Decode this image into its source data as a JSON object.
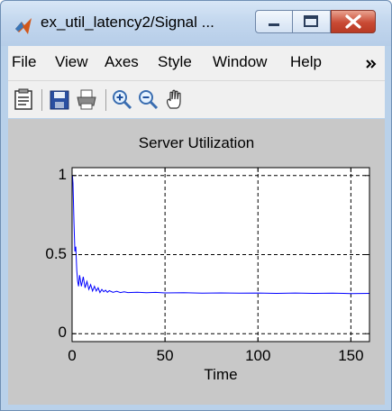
{
  "window": {
    "title": "ex_util_latency2/Signal ...",
    "colors": {
      "frame": "#b9d1ea",
      "close": "#c94a34",
      "menu_bg": "#f0f0f0",
      "figure_bg": "#c8c8c8",
      "trace": "#0000ff"
    }
  },
  "menubar": {
    "items": [
      "File",
      "View",
      "Axes",
      "Style",
      "Window",
      "Help"
    ],
    "overflow_icon": "chevron-right-icon"
  },
  "toolbar": {
    "icons": [
      "parameters-icon",
      "save-icon",
      "print-icon",
      "zoom-in-icon",
      "zoom-out-icon",
      "pan-hand-icon"
    ]
  },
  "plot": {
    "title": "Server Utilization",
    "xlabel": "Time"
  },
  "chart_data": {
    "type": "line",
    "title": "Server Utilization",
    "xlabel": "Time",
    "ylabel": "",
    "xlim": [
      0,
      160
    ],
    "ylim": [
      -0.05,
      1.05
    ],
    "xticks": [
      0,
      50,
      100,
      150
    ],
    "yticks": [
      0,
      0.5,
      1
    ],
    "xtick_labels": [
      "0",
      "50",
      "100",
      "150"
    ],
    "ytick_labels": [
      "0",
      "0.5",
      "1"
    ],
    "grid": true,
    "legend": "none",
    "series": [
      {
        "color": "#0000ff",
        "x": [
          0,
          0.2,
          0.5,
          1,
          1.5,
          2,
          2.5,
          3,
          3.5,
          4,
          5,
          6,
          7,
          8,
          9,
          10,
          11,
          12,
          13,
          14,
          15,
          16,
          17,
          18,
          19,
          20,
          22,
          24,
          26,
          28,
          30,
          35,
          40,
          45,
          50,
          60,
          70,
          80,
          90,
          100,
          110,
          120,
          130,
          140,
          150,
          160
        ],
        "y": [
          1.0,
          1.0,
          0.95,
          0.7,
          0.52,
          0.55,
          0.4,
          0.33,
          0.3,
          0.37,
          0.3,
          0.36,
          0.29,
          0.33,
          0.28,
          0.31,
          0.27,
          0.3,
          0.27,
          0.29,
          0.26,
          0.28,
          0.265,
          0.275,
          0.262,
          0.272,
          0.262,
          0.268,
          0.26,
          0.265,
          0.26,
          0.262,
          0.259,
          0.261,
          0.258,
          0.259,
          0.256,
          0.258,
          0.256,
          0.257,
          0.255,
          0.257,
          0.255,
          0.256,
          0.254,
          0.255
        ]
      }
    ]
  }
}
